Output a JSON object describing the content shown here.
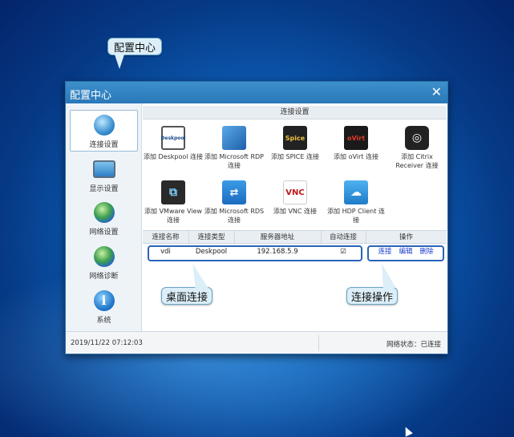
{
  "callouts": {
    "config_center": "配置中心",
    "desktop_connection": "桌面连接",
    "connection_actions": "连接操作"
  },
  "window": {
    "title": "配置中心",
    "close_label": "✕"
  },
  "sidebar": {
    "items": [
      {
        "label": "连接设置",
        "icon": "connection-settings-icon",
        "active": true
      },
      {
        "label": "显示设置",
        "icon": "display-settings-icon",
        "active": false
      },
      {
        "label": "网络设置",
        "icon": "network-settings-icon",
        "active": false
      },
      {
        "label": "网络诊断",
        "icon": "network-diagnosis-icon",
        "active": false
      },
      {
        "label": "系统",
        "icon": "system-info-icon",
        "active": false
      }
    ]
  },
  "main": {
    "section_title": "连接设置",
    "tiles": [
      {
        "label": "添加 Deskpool 连接",
        "icon": "deskpool-icon",
        "text": "Deskpool"
      },
      {
        "label": "添加 Microsoft RDP 连接",
        "icon": "microsoft-rdp-icon",
        "text": ""
      },
      {
        "label": "添加 SPICE 连接",
        "icon": "spice-icon",
        "text": "Spice"
      },
      {
        "label": "添加 oVirt 连接",
        "icon": "ovirt-icon",
        "text": "oVirt"
      },
      {
        "label": "添加 Citrix Receiver 连接",
        "icon": "citrix-receiver-icon",
        "text": ""
      },
      {
        "label": "添加 VMware View 连接",
        "icon": "vmware-view-icon",
        "text": ""
      },
      {
        "label": "添加 Microsoft RDS 连接",
        "icon": "microsoft-rds-icon",
        "text": ""
      },
      {
        "label": "添加 VNC 连接",
        "icon": "vnc-icon",
        "text": "VNC"
      },
      {
        "label": "添加 HDP Client 连接",
        "icon": "hdp-client-icon",
        "text": ""
      }
    ],
    "table": {
      "headers": [
        "连接名称",
        "连接类型",
        "服务器地址",
        "自动连接",
        "操作"
      ],
      "rows": [
        {
          "name": "vdi",
          "type": "Deskpool",
          "address": "192.168.5.9",
          "auto_connect": "☑",
          "actions": [
            "连接",
            "编辑",
            "删除"
          ]
        }
      ]
    }
  },
  "statusbar": {
    "datetime": "2019/11/22 07:12:03",
    "network_status": "网络状态：已连接"
  },
  "colors": {
    "accent": "#2a78b8",
    "link": "#1a3cd0",
    "highlight_border": "#2a64b8"
  }
}
